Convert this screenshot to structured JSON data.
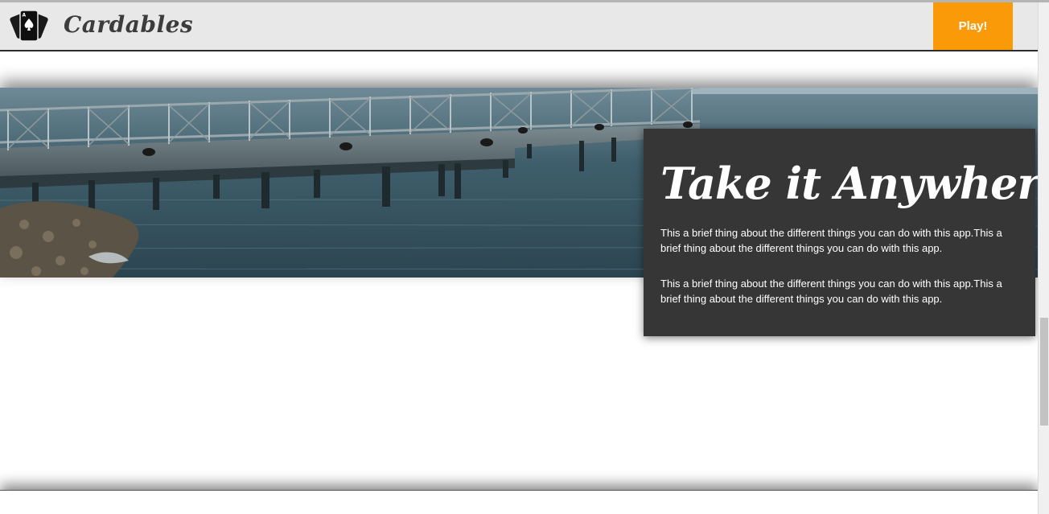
{
  "header": {
    "brand": "Cardables",
    "play_label": "Play!",
    "logo_icon": "playing-cards-icon"
  },
  "hero": {
    "image_icon": "pier-photo"
  },
  "card": {
    "title": "Take it Anywhere",
    "paragraphs": [
      "This a brief thing about the different things you can do with this app.This a brief thing about the different things you can do with this app.",
      "This a brief thing about the different things you can do with this app.This a brief thing about the different things you can do with this app."
    ]
  },
  "colors": {
    "accent": "#fb9a09",
    "navbar": "#e8e8e8",
    "card": "#363636"
  }
}
